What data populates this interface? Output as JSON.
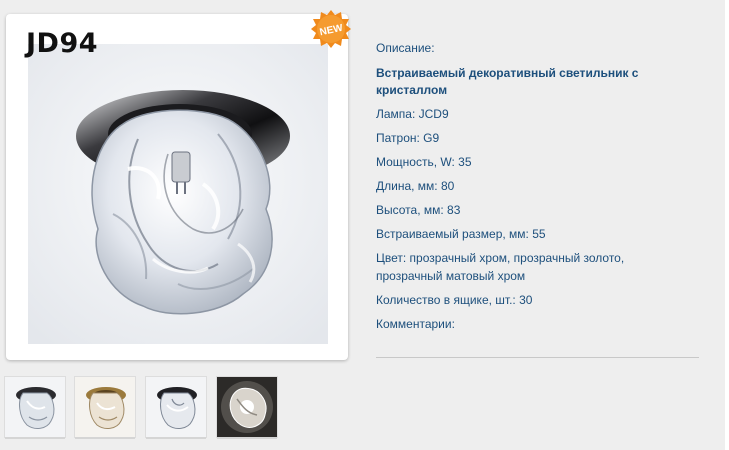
{
  "product": {
    "model": "JD94",
    "badge": "NEW"
  },
  "specs": {
    "description_label": "Описание:",
    "title_line1": "Встраиваемый декоративный светильник с",
    "title_line2": "кристаллом",
    "lamp": "Лампа: JCD9",
    "socket": "Патрон: G9",
    "power": "Мощность, W: 35",
    "length": "Длина, мм: 80",
    "height": "Высота, мм: 83",
    "cutout": "Встраиваемый размер, мм: 55",
    "color_line1": "Цвет: прозрачный хром, прозрачный золото,",
    "color_line2": "прозрачный матовый хром",
    "box_qty": "Количество в ящике, шт.: 30",
    "comments": "Комментарии:"
  },
  "thumbnails": [
    {
      "name": "thumbnail-chrome",
      "variant": "chrome"
    },
    {
      "name": "thumbnail-gold",
      "variant": "gold"
    },
    {
      "name": "thumbnail-matte-chrome",
      "variant": "chrome"
    },
    {
      "name": "thumbnail-lit",
      "variant": "lit"
    }
  ],
  "colors": {
    "text": "#1d4f7c",
    "badge": "#f08a1c",
    "background": "#eeeeee"
  }
}
